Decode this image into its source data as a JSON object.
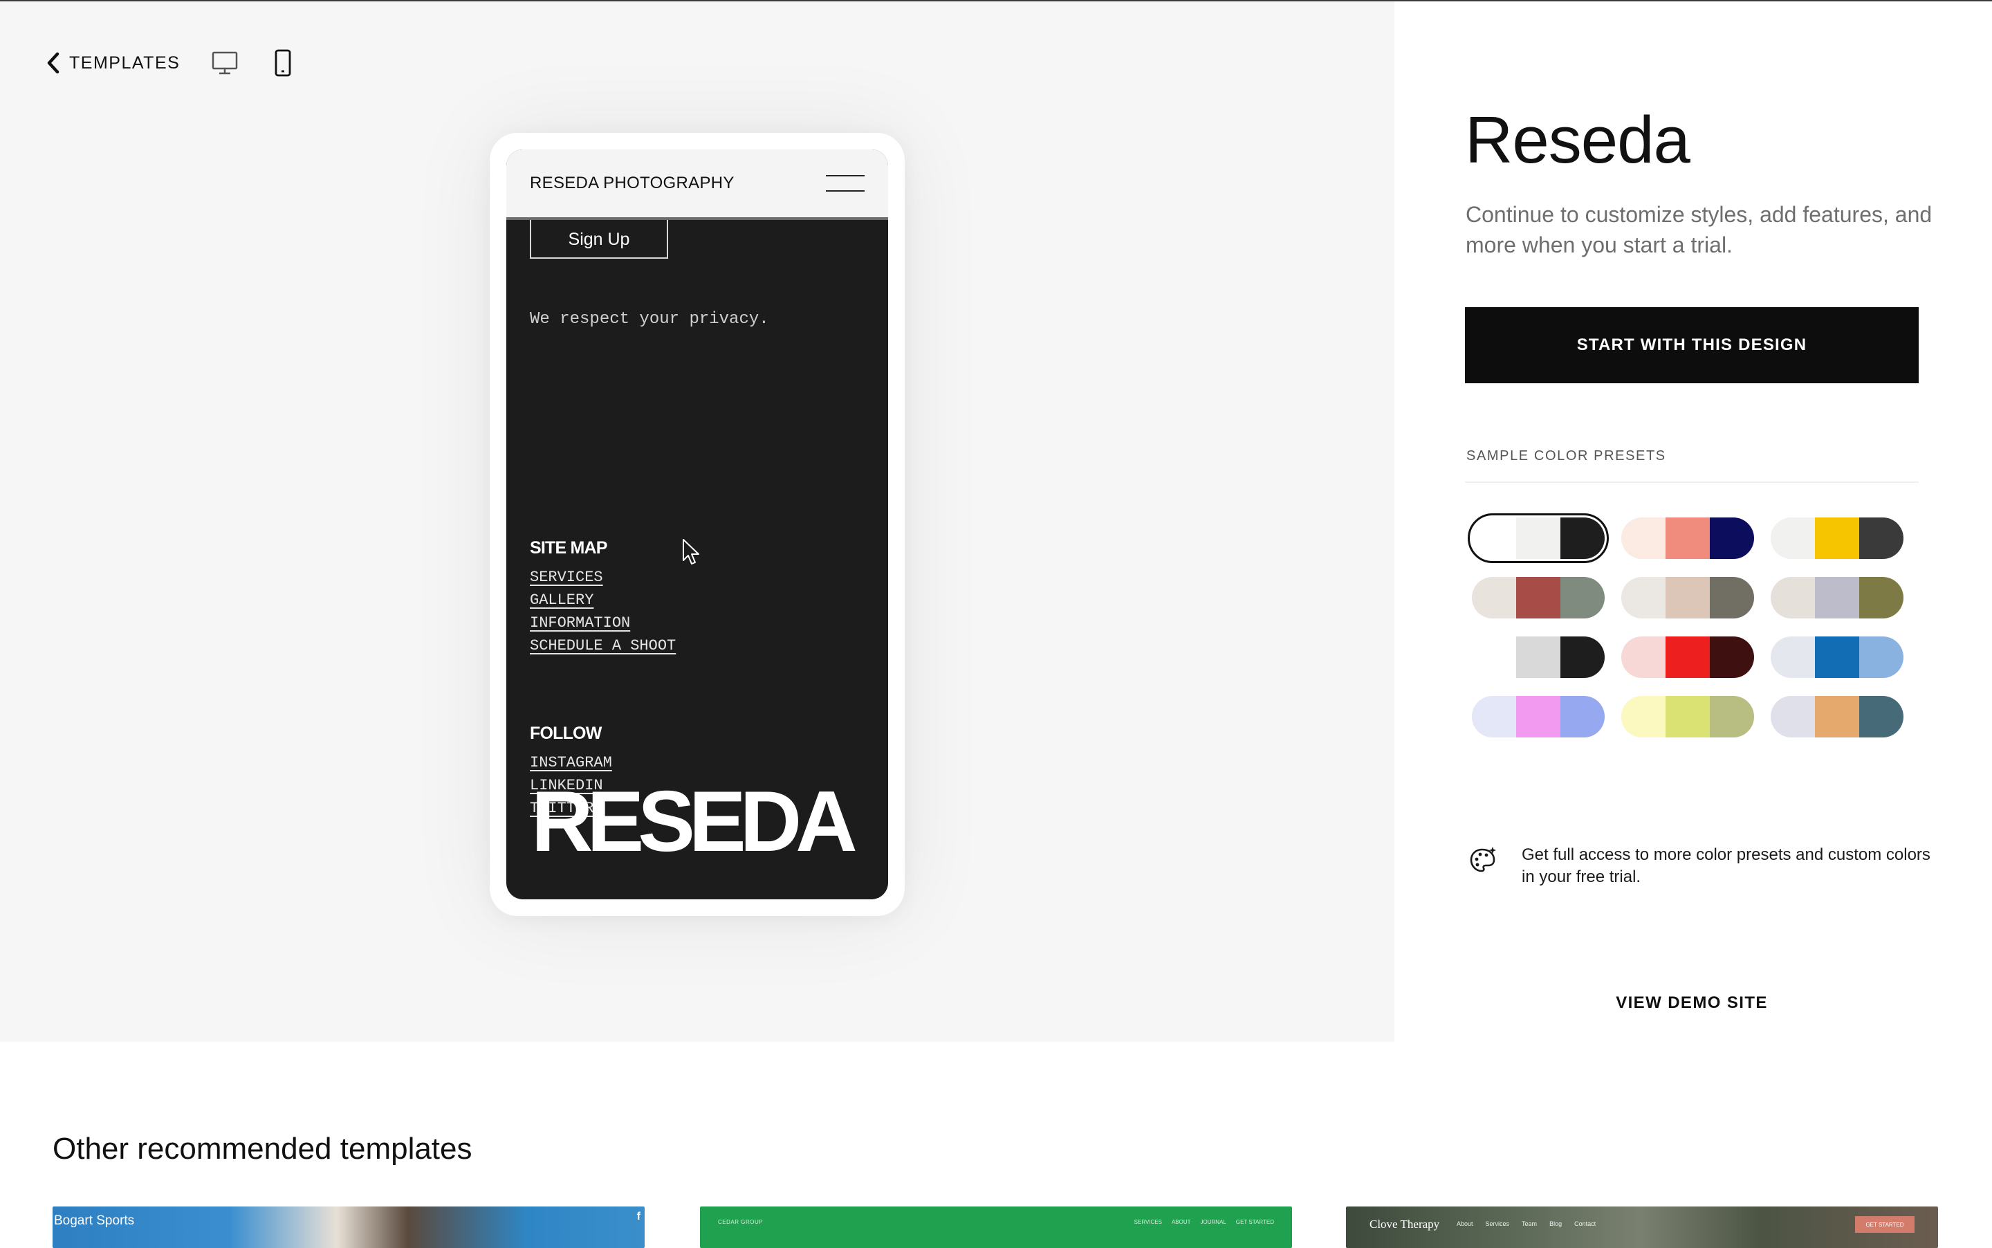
{
  "toolbar": {
    "back_label": "TEMPLATES"
  },
  "phone_preview": {
    "site_title": "RESEDA PHOTOGRAPHY",
    "signup_label": "Sign Up",
    "privacy_text": "We respect your privacy.",
    "sitemap": {
      "title": "SITE MAP",
      "links": [
        "SERVICES",
        "GALLERY",
        "INFORMATION",
        "SCHEDULE A SHOOT"
      ]
    },
    "follow": {
      "title": "FOLLOW",
      "links": [
        "INSTAGRAM",
        "LINKEDIN",
        "TWITTER"
      ]
    },
    "footer_wordmark": "RESEDA"
  },
  "panel": {
    "template_name": "Reseda",
    "description": "Continue to customize styles, add features, and more when you start a trial.",
    "start_button": "START WITH THIS DESIGN",
    "presets_label": "SAMPLE COLOR PRESETS",
    "presets": [
      {
        "colors": [
          "#ffffff",
          "#f1f1ef",
          "#1e1e1e"
        ],
        "selected": true
      },
      {
        "colors": [
          "#fcebe2",
          "#ef8c7d",
          "#0d0d5e"
        ],
        "selected": false
      },
      {
        "colors": [
          "#f1f1ef",
          "#f7c400",
          "#3a3a3a"
        ],
        "selected": false
      },
      {
        "colors": [
          "#e8e3dc",
          "#a84c47",
          "#7f8b7f"
        ],
        "selected": false
      },
      {
        "colors": [
          "#ebe8e4",
          "#dcc6b8",
          "#716e64"
        ],
        "selected": false
      },
      {
        "colors": [
          "#e5e0d9",
          "#bdbccb",
          "#7e7a45"
        ],
        "selected": false
      },
      {
        "colors": [
          "#ffffff",
          "#d9d9d9",
          "#1e1e1e"
        ],
        "selected": false
      },
      {
        "colors": [
          "#f8d8d6",
          "#ee1f1f",
          "#3f1010"
        ],
        "selected": false
      },
      {
        "colors": [
          "#e5e7ef",
          "#136db4",
          "#8ab2e0"
        ],
        "selected": false
      },
      {
        "colors": [
          "#e3e7f7",
          "#f29af0",
          "#96a8ef"
        ],
        "selected": false
      },
      {
        "colors": [
          "#fbf8c0",
          "#dbe274",
          "#b8bd81"
        ],
        "selected": false
      },
      {
        "colors": [
          "#e0e0ea",
          "#e6a96d",
          "#466a78"
        ],
        "selected": false
      }
    ],
    "note_icon": "palette-icon",
    "note_text": "Get full access to more color presets and custom colors in your free trial.",
    "view_demo": "VIEW DEMO SITE"
  },
  "recommended": {
    "title": "Other recommended templates",
    "templates": [
      {
        "name": "Bogart Sports",
        "social": "f"
      },
      {
        "name": "CEDAR GROUP",
        "nav": [
          "SERVICES",
          "ABOUT",
          "JOURNAL",
          "GET STARTED"
        ]
      },
      {
        "name": "Clove Therapy",
        "nav": [
          "About",
          "Services",
          "Team",
          "Blog",
          "Contact"
        ],
        "cta": "GET STARTED"
      }
    ]
  }
}
